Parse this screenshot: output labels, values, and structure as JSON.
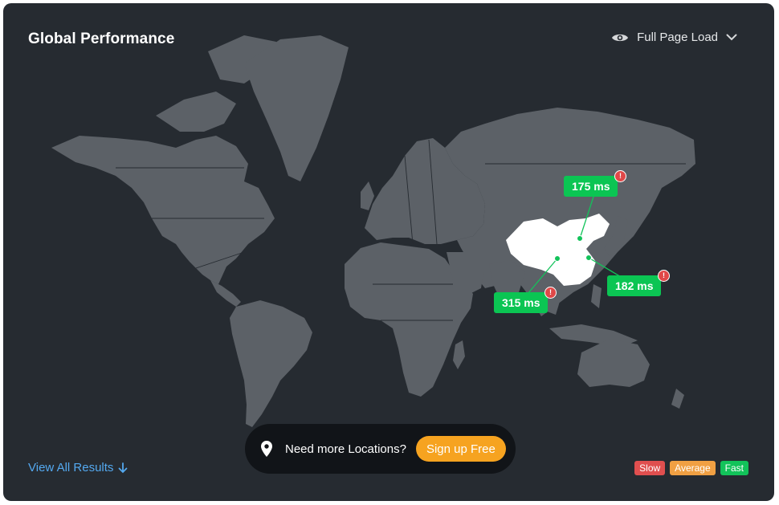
{
  "header": {
    "title": "Global Performance"
  },
  "metric_selector": {
    "label": "Full Page Load",
    "icon": "eye-icon"
  },
  "markers": [
    {
      "label": "175 ms",
      "status": "fast"
    },
    {
      "label": "182 ms",
      "status": "fast"
    },
    {
      "label": "315 ms",
      "status": "fast"
    }
  ],
  "footer": {
    "view_all": "View All Results",
    "promo_text": "Need more Locations?",
    "promo_button": "Sign up Free"
  },
  "legend": [
    {
      "label": "Slow",
      "color": "#e04f4f"
    },
    {
      "label": "Average",
      "color": "#f0a043"
    },
    {
      "label": "Fast",
      "color": "#12c35a"
    }
  ],
  "colors": {
    "background": "#262b31",
    "land": "#5c6167",
    "highlight": "#ffffff",
    "accent": "#54a9f0",
    "alert": "#e04848"
  }
}
